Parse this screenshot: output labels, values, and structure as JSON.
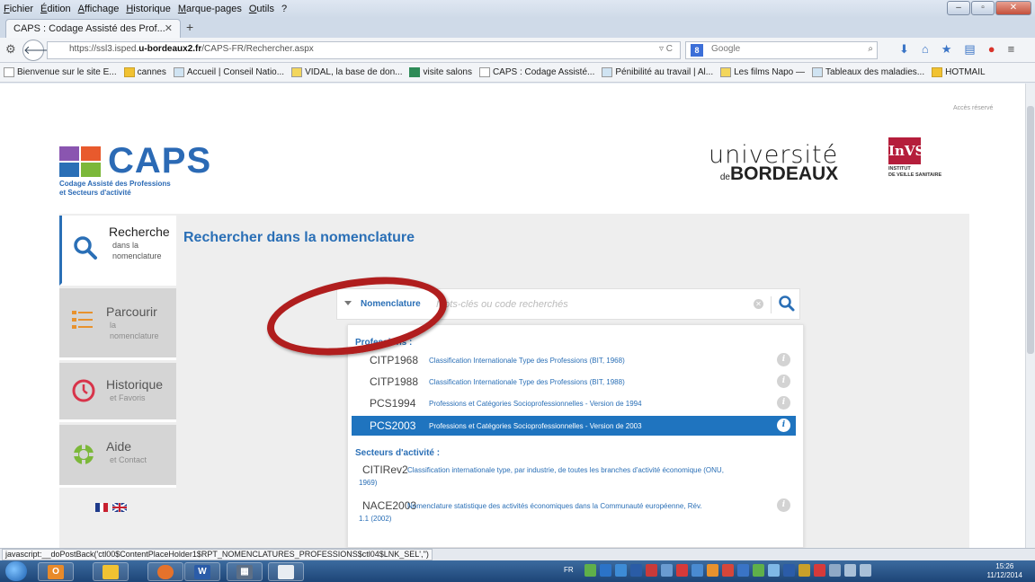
{
  "browser": {
    "menu": [
      "Fichier",
      "Édition",
      "Affichage",
      "Historique",
      "Marque-pages",
      "Outils",
      "?"
    ],
    "tab_title": "CAPS : Codage Assisté des Prof...",
    "url_prefix": "https://ssl3.isped.",
    "url_host": "u-bordeaux2.fr",
    "url_path": "/CAPS-FR/Rechercher.aspx",
    "search_engine": "Google",
    "bookmarks": [
      "Bienvenue sur le site E...",
      "cannes",
      "Accueil | Conseil Natio...",
      "VIDAL, la base de don...",
      "visite salons",
      "CAPS : Codage Assisté...",
      "Pénibilité au travail | Al...",
      "Les films Napo —",
      "Tableaux des maladies...",
      "HOTMAIL"
    ],
    "status_text": "javascript:__doPostBack('ctl00$ContentPlaceHolder1$RPT_NOMENCLATURES_PROFESSIONS$ctl04$LNK_SEL','')"
  },
  "header": {
    "acces": "Accès réservé",
    "caps_title": "CAPS",
    "caps_subtitle_1": "Codage Assisté des Professions",
    "caps_subtitle_2": "et Secteurs d'activité",
    "univ_line1": "université",
    "univ_de": "de",
    "univ_line2": "BORDEAUX",
    "invs_mark": "InVS",
    "invs_line1": "INSTITUT",
    "invs_line2": "DE VEILLE SANITAIRE"
  },
  "sidebar": {
    "items": [
      {
        "main": "Recherche",
        "sub1": "dans la",
        "sub2": "nomenclature"
      },
      {
        "main": "Parcourir",
        "sub1": "la",
        "sub2": "nomenclature"
      },
      {
        "main": "Historique",
        "sub1": "et Favoris"
      },
      {
        "main": "Aide",
        "sub1": "et Contact"
      }
    ]
  },
  "main": {
    "title": "Rechercher dans la nomenclature",
    "nomenclature_label": "Nomenclature",
    "search_placeholder": "Mots-clés ou code recherchés",
    "section_professions": "Professions :",
    "section_secteurs": "Secteurs d'activité :",
    "professions": [
      {
        "code": "CITP1968",
        "desc": "Classification Internationale Type des Professions (BIT, 1968)"
      },
      {
        "code": "CITP1988",
        "desc": "Classification Internationale Type des Professions (BIT, 1988)"
      },
      {
        "code": "PCS1994",
        "desc": "Professions et Catégories Socioprofessionnelles - Version de 1994"
      },
      {
        "code": "PCS2003",
        "desc": "Professions et Catégories Socioprofessionnelles - Version de 2003"
      }
    ],
    "secteurs": [
      {
        "code": "CITIRev2",
        "desc": "Classification internationale type, par industrie, de toutes les branches d'activité économique (ONU,",
        "desc2": "1969)"
      },
      {
        "code": "NACE2003",
        "desc": "Nomenclature statistique des activités économiques dans la Communauté européenne, Rév.",
        "desc2": "1.1 (2002)"
      }
    ],
    "selected_index": 3
  },
  "taskbar": {
    "lang": "FR",
    "time": "15:26",
    "date": "11/12/2014"
  },
  "colors": {
    "accent": "#2a6fb6",
    "selected_row": "#1f74bf",
    "annotation_circle": "#b01e1e"
  }
}
